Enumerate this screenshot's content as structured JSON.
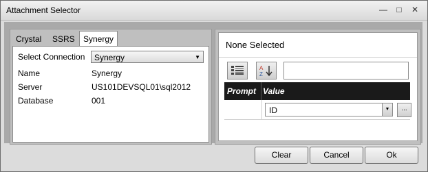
{
  "window": {
    "title": "Attachment Selector"
  },
  "controls": {
    "minimize": "—",
    "maximize": "□",
    "close": "✕"
  },
  "left": {
    "tabs": [
      {
        "label": "Crystal"
      },
      {
        "label": "SSRS"
      },
      {
        "label": "Synergy",
        "active": true
      }
    ],
    "select_connection_label": "Select Connection",
    "select_connection_value": "Synergy",
    "fields": [
      {
        "label": "Name",
        "value": "Synergy"
      },
      {
        "label": "Server",
        "value": "US101DEVSQL01\\sql2012"
      },
      {
        "label": "Database",
        "value": "001"
      }
    ]
  },
  "right": {
    "header": "None Selected",
    "search_value": "",
    "grid": {
      "columns": [
        "Prompt",
        "Value"
      ],
      "rows": [
        {
          "prompt": "",
          "value": "ID"
        }
      ]
    },
    "ellipsis": "..."
  },
  "buttons": {
    "clear": "Clear",
    "cancel": "Cancel",
    "ok": "Ok"
  }
}
